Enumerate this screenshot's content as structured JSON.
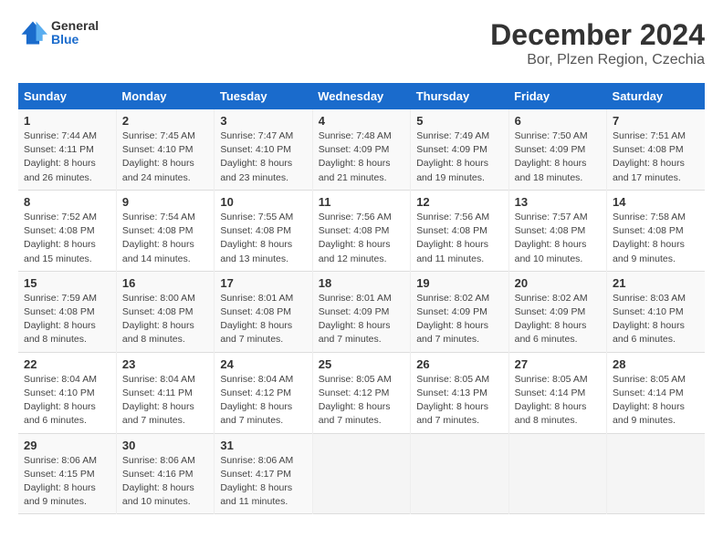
{
  "header": {
    "logo_general": "General",
    "logo_blue": "Blue",
    "month_title": "December 2024",
    "location": "Bor, Plzen Region, Czechia"
  },
  "columns": [
    "Sunday",
    "Monday",
    "Tuesday",
    "Wednesday",
    "Thursday",
    "Friday",
    "Saturday"
  ],
  "weeks": [
    [
      {
        "day": "1",
        "sunrise": "Sunrise: 7:44 AM",
        "sunset": "Sunset: 4:11 PM",
        "daylight": "Daylight: 8 hours and 26 minutes."
      },
      {
        "day": "2",
        "sunrise": "Sunrise: 7:45 AM",
        "sunset": "Sunset: 4:10 PM",
        "daylight": "Daylight: 8 hours and 24 minutes."
      },
      {
        "day": "3",
        "sunrise": "Sunrise: 7:47 AM",
        "sunset": "Sunset: 4:10 PM",
        "daylight": "Daylight: 8 hours and 23 minutes."
      },
      {
        "day": "4",
        "sunrise": "Sunrise: 7:48 AM",
        "sunset": "Sunset: 4:09 PM",
        "daylight": "Daylight: 8 hours and 21 minutes."
      },
      {
        "day": "5",
        "sunrise": "Sunrise: 7:49 AM",
        "sunset": "Sunset: 4:09 PM",
        "daylight": "Daylight: 8 hours and 19 minutes."
      },
      {
        "day": "6",
        "sunrise": "Sunrise: 7:50 AM",
        "sunset": "Sunset: 4:09 PM",
        "daylight": "Daylight: 8 hours and 18 minutes."
      },
      {
        "day": "7",
        "sunrise": "Sunrise: 7:51 AM",
        "sunset": "Sunset: 4:08 PM",
        "daylight": "Daylight: 8 hours and 17 minutes."
      }
    ],
    [
      {
        "day": "8",
        "sunrise": "Sunrise: 7:52 AM",
        "sunset": "Sunset: 4:08 PM",
        "daylight": "Daylight: 8 hours and 15 minutes."
      },
      {
        "day": "9",
        "sunrise": "Sunrise: 7:54 AM",
        "sunset": "Sunset: 4:08 PM",
        "daylight": "Daylight: 8 hours and 14 minutes."
      },
      {
        "day": "10",
        "sunrise": "Sunrise: 7:55 AM",
        "sunset": "Sunset: 4:08 PM",
        "daylight": "Daylight: 8 hours and 13 minutes."
      },
      {
        "day": "11",
        "sunrise": "Sunrise: 7:56 AM",
        "sunset": "Sunset: 4:08 PM",
        "daylight": "Daylight: 8 hours and 12 minutes."
      },
      {
        "day": "12",
        "sunrise": "Sunrise: 7:56 AM",
        "sunset": "Sunset: 4:08 PM",
        "daylight": "Daylight: 8 hours and 11 minutes."
      },
      {
        "day": "13",
        "sunrise": "Sunrise: 7:57 AM",
        "sunset": "Sunset: 4:08 PM",
        "daylight": "Daylight: 8 hours and 10 minutes."
      },
      {
        "day": "14",
        "sunrise": "Sunrise: 7:58 AM",
        "sunset": "Sunset: 4:08 PM",
        "daylight": "Daylight: 8 hours and 9 minutes."
      }
    ],
    [
      {
        "day": "15",
        "sunrise": "Sunrise: 7:59 AM",
        "sunset": "Sunset: 4:08 PM",
        "daylight": "Daylight: 8 hours and 8 minutes."
      },
      {
        "day": "16",
        "sunrise": "Sunrise: 8:00 AM",
        "sunset": "Sunset: 4:08 PM",
        "daylight": "Daylight: 8 hours and 8 minutes."
      },
      {
        "day": "17",
        "sunrise": "Sunrise: 8:01 AM",
        "sunset": "Sunset: 4:08 PM",
        "daylight": "Daylight: 8 hours and 7 minutes."
      },
      {
        "day": "18",
        "sunrise": "Sunrise: 8:01 AM",
        "sunset": "Sunset: 4:09 PM",
        "daylight": "Daylight: 8 hours and 7 minutes."
      },
      {
        "day": "19",
        "sunrise": "Sunrise: 8:02 AM",
        "sunset": "Sunset: 4:09 PM",
        "daylight": "Daylight: 8 hours and 7 minutes."
      },
      {
        "day": "20",
        "sunrise": "Sunrise: 8:02 AM",
        "sunset": "Sunset: 4:09 PM",
        "daylight": "Daylight: 8 hours and 6 minutes."
      },
      {
        "day": "21",
        "sunrise": "Sunrise: 8:03 AM",
        "sunset": "Sunset: 4:10 PM",
        "daylight": "Daylight: 8 hours and 6 minutes."
      }
    ],
    [
      {
        "day": "22",
        "sunrise": "Sunrise: 8:04 AM",
        "sunset": "Sunset: 4:10 PM",
        "daylight": "Daylight: 8 hours and 6 minutes."
      },
      {
        "day": "23",
        "sunrise": "Sunrise: 8:04 AM",
        "sunset": "Sunset: 4:11 PM",
        "daylight": "Daylight: 8 hours and 7 minutes."
      },
      {
        "day": "24",
        "sunrise": "Sunrise: 8:04 AM",
        "sunset": "Sunset: 4:12 PM",
        "daylight": "Daylight: 8 hours and 7 minutes."
      },
      {
        "day": "25",
        "sunrise": "Sunrise: 8:05 AM",
        "sunset": "Sunset: 4:12 PM",
        "daylight": "Daylight: 8 hours and 7 minutes."
      },
      {
        "day": "26",
        "sunrise": "Sunrise: 8:05 AM",
        "sunset": "Sunset: 4:13 PM",
        "daylight": "Daylight: 8 hours and 7 minutes."
      },
      {
        "day": "27",
        "sunrise": "Sunrise: 8:05 AM",
        "sunset": "Sunset: 4:14 PM",
        "daylight": "Daylight: 8 hours and 8 minutes."
      },
      {
        "day": "28",
        "sunrise": "Sunrise: 8:05 AM",
        "sunset": "Sunset: 4:14 PM",
        "daylight": "Daylight: 8 hours and 9 minutes."
      }
    ],
    [
      {
        "day": "29",
        "sunrise": "Sunrise: 8:06 AM",
        "sunset": "Sunset: 4:15 PM",
        "daylight": "Daylight: 8 hours and 9 minutes."
      },
      {
        "day": "30",
        "sunrise": "Sunrise: 8:06 AM",
        "sunset": "Sunset: 4:16 PM",
        "daylight": "Daylight: 8 hours and 10 minutes."
      },
      {
        "day": "31",
        "sunrise": "Sunrise: 8:06 AM",
        "sunset": "Sunset: 4:17 PM",
        "daylight": "Daylight: 8 hours and 11 minutes."
      },
      null,
      null,
      null,
      null
    ]
  ]
}
